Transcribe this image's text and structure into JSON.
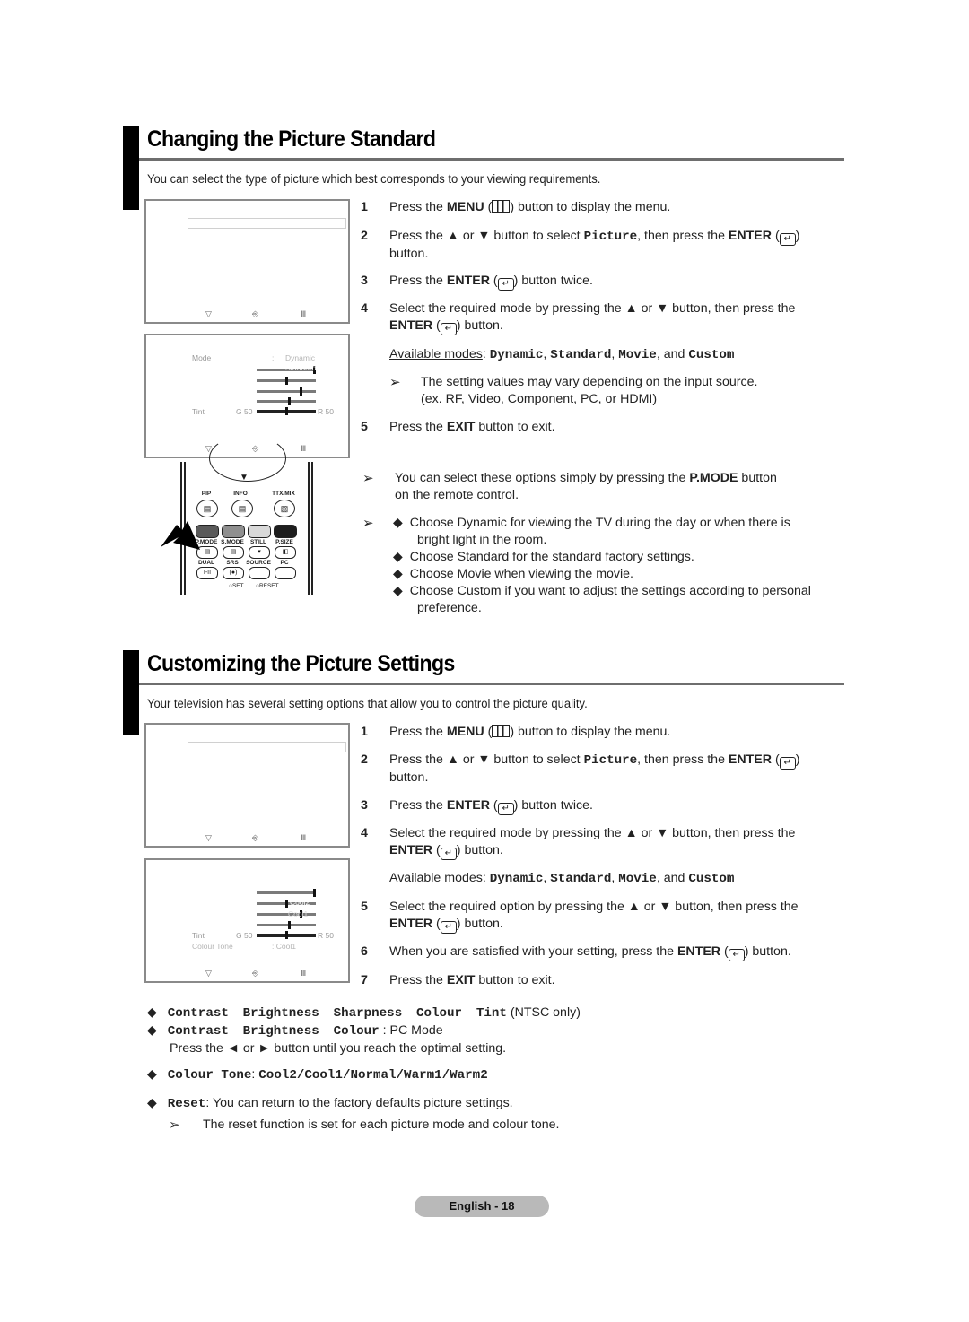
{
  "section1": {
    "title": "Changing the Picture Standard",
    "intro": "You can select the type of picture which best corresponds to your viewing requirements.",
    "steps": [
      {
        "num": "1",
        "pre": "Press the ",
        "bold": "MENU",
        "mid": " (",
        "post": ") button to display the menu."
      },
      {
        "num": "2",
        "pre": "Press the ▲ or ▼ button to select ",
        "mono": "Picture",
        "mid": ", then press the ",
        "bold": "ENTER",
        "post": " button."
      },
      {
        "num": "3",
        "pre": "Press the ",
        "bold": "ENTER",
        "post": " button twice."
      },
      {
        "num": "4",
        "pre": "Select the required mode by pressing the ▲ or ▼ button, then press the",
        "bold": "ENTER",
        "post": " button."
      },
      {
        "num": "5",
        "pre": "Press the ",
        "bold": "EXIT",
        "post": " button to exit."
      }
    ],
    "available_label": "Available modes",
    "modes": [
      "Dynamic",
      "Standard",
      "Movie",
      "Custom"
    ],
    "and_word": "and",
    "note_source": "The setting values may vary depending on the input source.",
    "note_source_2": "(ex. RF, Video, Component, PC, or HDMI)",
    "note_pmode_pre": "You can select these options simply by pressing the ",
    "note_pmode_bold": "P.MODE",
    "note_pmode_post": " button",
    "note_pmode_2": "on the remote control.",
    "bullets": [
      "Choose Dynamic for viewing the TV during the day or when there is",
      "bright light in the room.",
      "Choose Standard for the standard factory settings.",
      "Choose Movie when viewing the movie.",
      "Choose Custom if you want to adjust the settings according to personal",
      "preference."
    ],
    "osd": {
      "mode_label": "Mode",
      "mode_value": "Dynamic",
      "overlay_values": [
        "Standard",
        "Movie",
        "Custom"
      ],
      "tint_label": "Tint",
      "tint_left": "G 50",
      "tint_right": "R 50",
      "slider_levels": [
        1.0,
        0.5,
        0.75,
        0.55,
        0.5
      ]
    }
  },
  "remote": {
    "top_labels": [
      "PIP",
      "INFO",
      "TTX/MIX"
    ],
    "row2_labels": [
      "P.MODE",
      "S.MODE",
      "STILL",
      "P.SIZE"
    ],
    "row3_labels": [
      "DUAL",
      "SRS",
      "SOURCE",
      "PC"
    ],
    "dual_glyph": "I-II",
    "srs_glyph": "(●)",
    "set_label": "SET",
    "reset_label": "RESET",
    "color_buttons": [
      "#5a5a5a",
      "#8f8f8f",
      "#d9d9d9",
      "#1e1e1e"
    ]
  },
  "section2": {
    "title": "Customizing the Picture Settings",
    "intro": "Your television has several setting options that allow you to control the picture quality.",
    "steps": [
      {
        "num": "1",
        "pre": "Press the ",
        "bold": "MENU",
        "post": ") button to display the menu."
      },
      {
        "num": "2",
        "pre": "Press the ▲ or ▼ button to select ",
        "mono": "Picture",
        "mid": ", then press the ",
        "bold": "ENTER",
        "post": " button."
      },
      {
        "num": "3",
        "pre": "Press the ",
        "bold": "ENTER",
        "post": " button twice."
      },
      {
        "num": "4",
        "pre": "Select the required mode by pressing the ▲ or ▼ button, then press the",
        "bold": "ENTER",
        "post": " button."
      },
      {
        "num": "5",
        "pre": "Select the required option by pressing the ▲ or ▼ button, then press the",
        "bold": "ENTER",
        "post": " button."
      },
      {
        "num": "6",
        "pre": "When you are satisfied with your setting, press the ",
        "bold": "ENTER",
        "post": " button."
      },
      {
        "num": "7",
        "pre": "Press the ",
        "bold": "EXIT",
        "post": " button to exit."
      }
    ],
    "available_label": "Available modes",
    "modes": [
      "Dynamic",
      "Standard",
      "Movie",
      "Custom"
    ],
    "and_word": "and",
    "osd": {
      "overlay_values": [
        "Cool2",
        "Cool1",
        "Normal",
        "Warm1"
      ],
      "tint_label": "Tint",
      "tint_left": "G 50",
      "tint_right": "R 50",
      "tone_label": "Colour Tone",
      "tone_value": "Cool1",
      "slider_levels": [
        1.0,
        0.5,
        0.75,
        0.55,
        0.5
      ]
    },
    "list1_items": [
      "Contrast",
      "Brightness",
      "Sharpness",
      "Colour",
      "Tint"
    ],
    "list1_suffix": "(NTSC only)",
    "list2_items": [
      "Contrast",
      "Brightness",
      "Colour"
    ],
    "list2_suffix": ": PC Mode",
    "press_line": "Press the ◄ or ► button until you reach the optimal setting.",
    "tone_label": "Colour Tone",
    "tone_values": "Cool2/Cool1/Normal/Warm1/Warm2",
    "reset_label": "Reset",
    "reset_text": ": You can return to the factory defaults picture settings.",
    "reset_note": "The reset function is set for each picture mode and colour tone."
  },
  "footer": {
    "page_label": "English - 18"
  }
}
